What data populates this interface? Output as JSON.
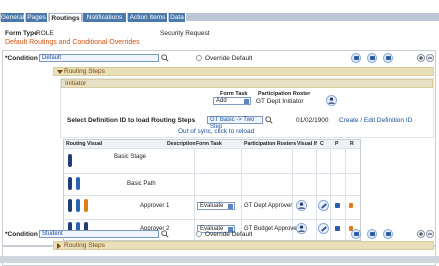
{
  "tabs": [
    "General",
    "Pages",
    "Routings",
    "Notifications",
    "Action Items",
    "Data"
  ],
  "header": {
    "form_type_label": "Form Type",
    "form_type_value": "ROLE",
    "form_name_value": "Security Request"
  },
  "section_title": "Default Routings and Conditional Overrides",
  "condition1": {
    "label": "*Condition",
    "value": "Default",
    "override_label": "Override Default",
    "routing_steps_label": "Routing Steps",
    "initiator_label": "Initiator",
    "form_task_header": "Form Task",
    "participation_roster_header": "Participation Roster",
    "form_task_value": "Add",
    "roster_value": "GT Dept Initiator",
    "select_def_label": "Select Definition ID to load Routing Steps",
    "definition_value": "GT Basic -> Two Step",
    "date_value": "01/02/1900",
    "create_edit_link": "Create / Edit Definition ID",
    "sync_message": "Out of sync, click to reload"
  },
  "grid": {
    "headers": [
      "Routing Visual",
      "Description",
      "Form Task",
      "Participation Rosters",
      "Visual If",
      "C",
      "P",
      "R"
    ],
    "rows": [
      {
        "description": "Basic Stage",
        "form_task": "",
        "roster": ""
      },
      {
        "description": "Basic Path",
        "form_task": "",
        "roster": ""
      },
      {
        "description": "Approver 1",
        "form_task": "Evaluate",
        "roster": "GT Dept Approver"
      },
      {
        "description": "Approver 2",
        "form_task": "Evaluate",
        "roster": "GT Budget Approver"
      }
    ]
  },
  "condition2": {
    "label": "*Condition",
    "value": "Student",
    "override_label": "Override Default",
    "routing_steps_label": "Routing Steps"
  },
  "colors": {
    "tab_blue": "#4b79ab",
    "accent_orange": "#d4500f",
    "band_tan": "#e9dfb8",
    "pill_navy": "#1f3f78",
    "pill_blue": "#2b66b6",
    "pill_orange": "#e07b1c"
  }
}
